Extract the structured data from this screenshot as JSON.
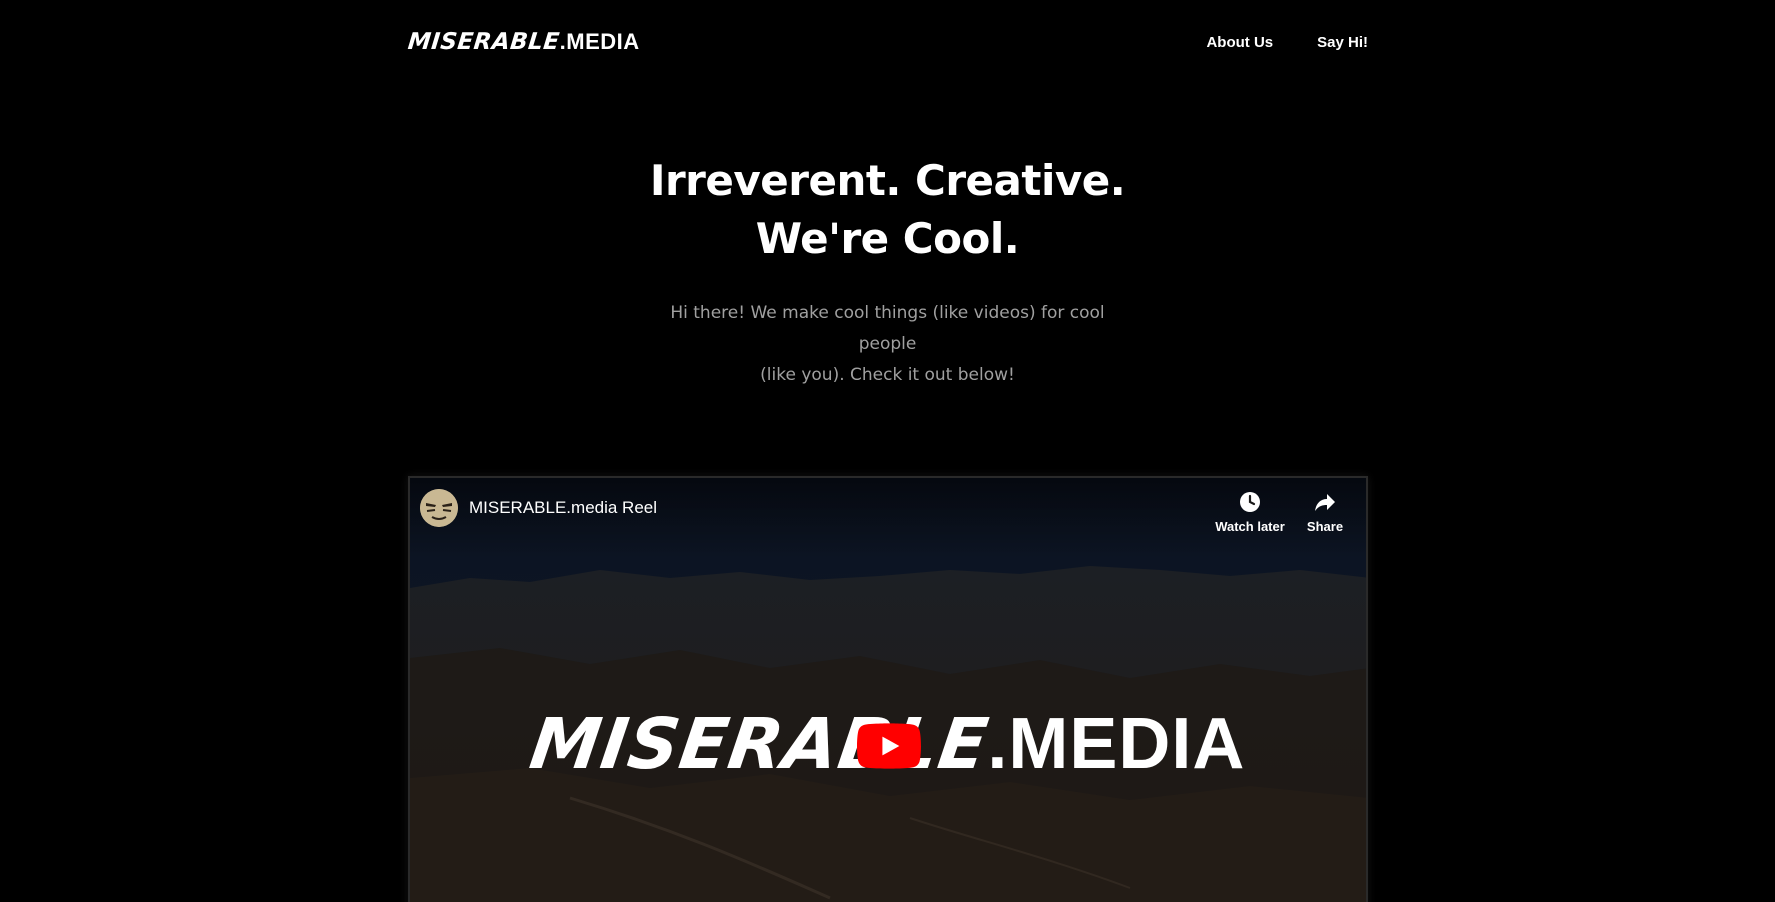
{
  "header": {
    "logo_brush": "MISERABLE",
    "logo_media": ".MEDIA",
    "nav": [
      {
        "label": "About Us"
      },
      {
        "label": "Say Hi!"
      }
    ]
  },
  "hero": {
    "title_line1": "Irreverent. Creative.",
    "title_line2": "We're Cool.",
    "subtitle_line1": "Hi there! We make cool things (like videos) for cool people",
    "subtitle_line2": "(like you). Check it out below!"
  },
  "video": {
    "title": "MISERABLE.media Reel",
    "watch_later_label": "Watch later",
    "share_label": "Share",
    "brand_brush": "MISERABLE",
    "brand_media": ".MEDIA",
    "play_color": "#ff0000"
  },
  "colors": {
    "background": "#000000",
    "text": "#ffffff",
    "subtitle": "#a0a0a0"
  }
}
